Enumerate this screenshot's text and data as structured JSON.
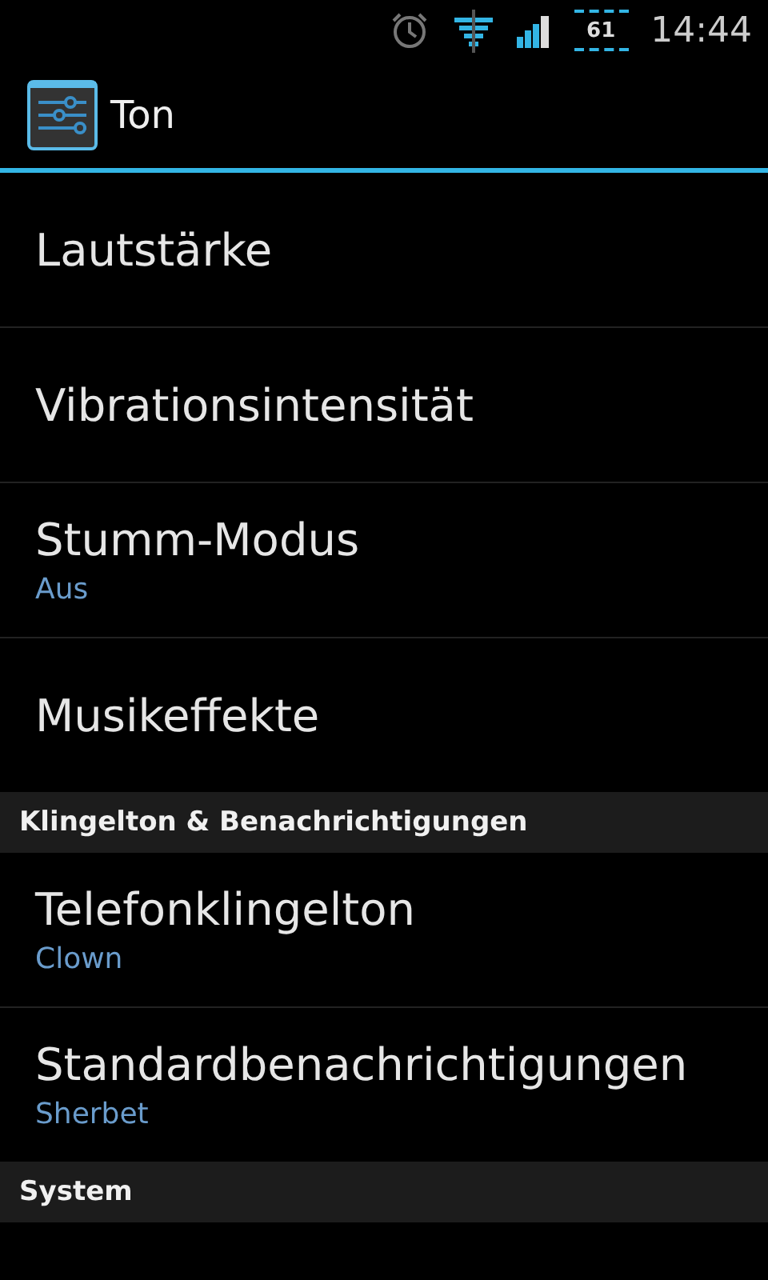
{
  "status_bar": {
    "battery": "61",
    "time": "14:44"
  },
  "action_bar": {
    "title": "Ton"
  },
  "items": [
    {
      "kind": "item",
      "title": "Lautstärke"
    },
    {
      "kind": "item",
      "title": "Vibrationsintensität"
    },
    {
      "kind": "item",
      "title": "Stumm-Modus",
      "summary": "Aus"
    },
    {
      "kind": "item",
      "title": "Musikeffekte"
    },
    {
      "kind": "header",
      "title": "Klingelton & Benachrichtigungen"
    },
    {
      "kind": "item",
      "title": "Telefonklingelton",
      "summary": "Clown"
    },
    {
      "kind": "item",
      "title": "Standardbenachrichtigungen",
      "summary": "Sherbet"
    },
    {
      "kind": "header",
      "title": "System"
    }
  ]
}
